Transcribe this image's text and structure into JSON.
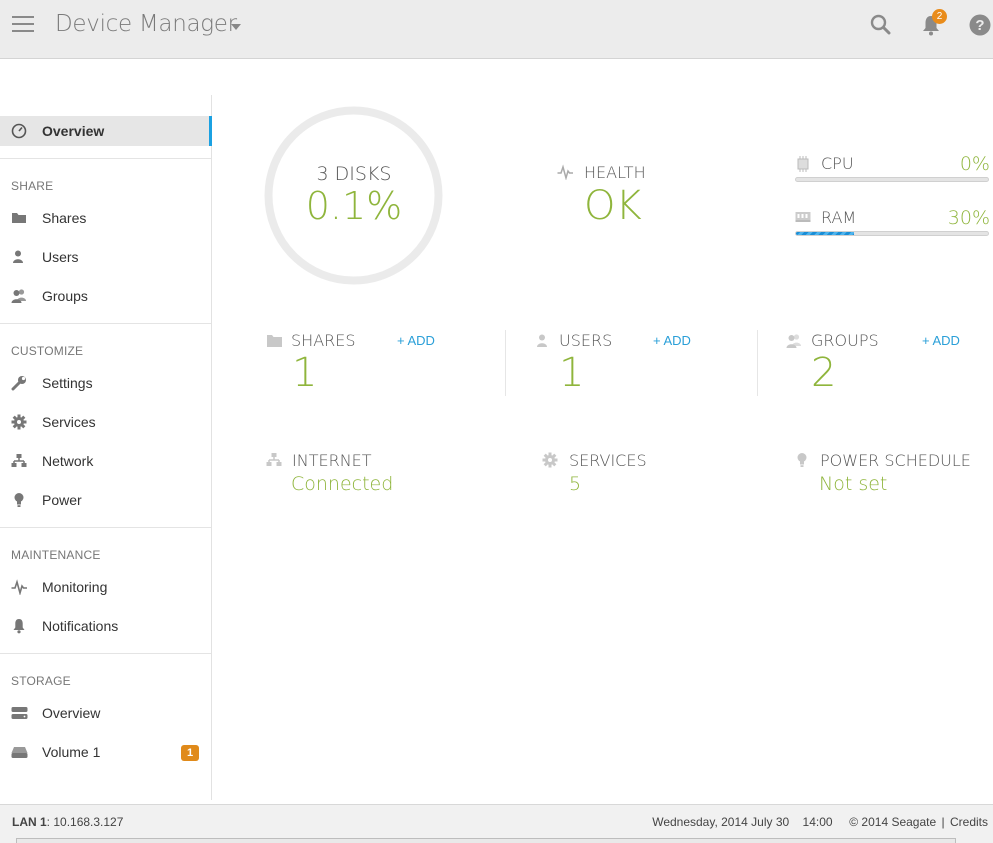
{
  "header": {
    "title": "Device Manager",
    "notification_count": "2",
    "icons": [
      "menu-icon",
      "search-icon",
      "bell-icon",
      "help-icon"
    ]
  },
  "sidebar": {
    "overview": "Overview",
    "sections": {
      "share": "SHARE",
      "customize": "CUSTOMIZE",
      "maintenance": "MAINTENANCE",
      "storage": "STORAGE"
    },
    "items": {
      "shares": "Shares",
      "users": "Users",
      "groups": "Groups",
      "settings": "Settings",
      "services": "Services",
      "network": "Network",
      "power": "Power",
      "monitoring": "Monitoring",
      "notifications": "Notifications",
      "storage_overview": "Overview",
      "volume1": "Volume 1"
    },
    "volume1_badge": "1",
    "accent": "#1ba1e2"
  },
  "dashboard": {
    "disks": {
      "label": "3 DISKS",
      "value": "0.1%",
      "fraction": 0.001
    },
    "health": {
      "label": "HEALTH",
      "value": "OK"
    },
    "cpu": {
      "label": "CPU",
      "value": "0%",
      "fraction": 0.0
    },
    "ram": {
      "label": "RAM",
      "value": "30%",
      "fraction": 0.3
    },
    "shares": {
      "label": "SHARES",
      "count": "1",
      "add": "+ ADD"
    },
    "users": {
      "label": "USERS",
      "count": "1",
      "add": "+ ADD"
    },
    "groups": {
      "label": "GROUPS",
      "count": "2",
      "add": "+ ADD"
    },
    "internet": {
      "label": "INTERNET",
      "value": "Connected"
    },
    "services": {
      "label": "SERVICES",
      "value": "5"
    },
    "power_schedule": {
      "label": "POWER SCHEDULE",
      "value": "Not set"
    },
    "value_color": "#8fb53c",
    "link_color": "#2a9fd8"
  },
  "footer": {
    "lan_label": "LAN 1",
    "lan_ip": ": 10.168.3.127",
    "datetime": "Wednesday, 2014 July 30    14:00",
    "copyright": "© 2014 Seagate",
    "credits": "Credits"
  }
}
